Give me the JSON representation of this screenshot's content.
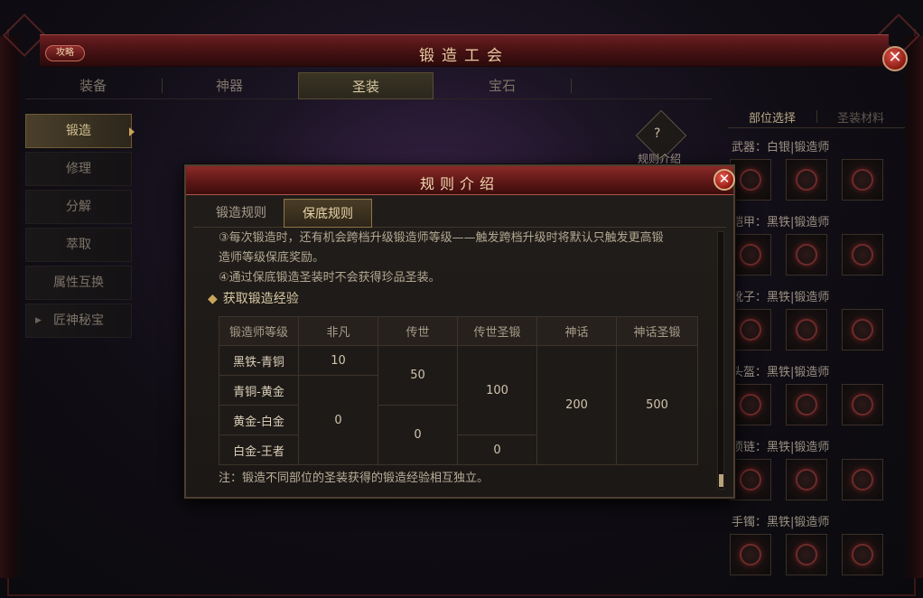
{
  "header": {
    "title": "锻造工会",
    "strategy_label": "攻略",
    "close_glyph": "✕",
    "faint_top_text": "",
    "faint_top_right": ""
  },
  "main_tabs": [
    "装备",
    "神器",
    "圣装",
    "宝石"
  ],
  "main_tab_active_index": 2,
  "sidebar": {
    "items": [
      {
        "label": "锻造",
        "active": true
      },
      {
        "label": "修理",
        "active": false
      },
      {
        "label": "分解",
        "active": false
      },
      {
        "label": "萃取",
        "active": false
      },
      {
        "label": "属性互换",
        "active": false
      },
      {
        "label": "匠神秘宝",
        "active": false,
        "expand_icon": "▶"
      }
    ]
  },
  "rule_button": {
    "label": "规则介绍",
    "icon": "scroll-icon",
    "glyph": "?"
  },
  "right_panel": {
    "tabs": [
      {
        "label": "部位选择",
        "active": true
      },
      {
        "label": "圣装材料",
        "active": false
      }
    ],
    "slots": [
      {
        "label": "武器：白银|锻造师"
      },
      {
        "label": "铠甲：黑铁|锻造师"
      },
      {
        "label": "靴子：黑铁|锻造师"
      },
      {
        "label": "头盔：黑铁|锻造师"
      },
      {
        "label": "项链：黑铁|锻造师"
      },
      {
        "label": "手镯：黑铁|锻造师"
      }
    ]
  },
  "modal": {
    "title": "规则介绍",
    "close_glyph": "✕",
    "tabs": [
      {
        "label": "锻造规则",
        "active": false
      },
      {
        "label": "保底规则",
        "active": true
      }
    ],
    "lines": [
      "③每次锻造时，还有机会跨档升级锻造师等级——触发跨档升级时将默认只触发更高锻",
      "造师等级保底奖励。",
      "④通过保底锻造圣装时不会获得珍品圣装。"
    ],
    "section_title": "获取锻造经验",
    "section_icon": "◆",
    "table": {
      "headers": [
        "锻造师等级",
        "非凡",
        "传世",
        "传世圣锻",
        "神话",
        "神话圣锻"
      ],
      "rows": [
        "黑铁-青铜",
        "青铜-黄金",
        "黄金-白金",
        "白金-王者"
      ],
      "cells": {
        "r0_feifan": "10",
        "r1to3_feifan": "0",
        "r0to1_chuanshi": "50",
        "r2to3_chuanshi": "0",
        "r0to2_shengduan": "100",
        "r3_shengduan": "0",
        "shenhua": "200",
        "shenhua_shengduan": "500"
      }
    },
    "note": "注：锻造不同部位的圣装获得的锻造经验相互独立。"
  },
  "colors": {
    "accent_gold": "#c9a45a",
    "title_red": "#6b1f22",
    "close_red": "#921b14"
  }
}
